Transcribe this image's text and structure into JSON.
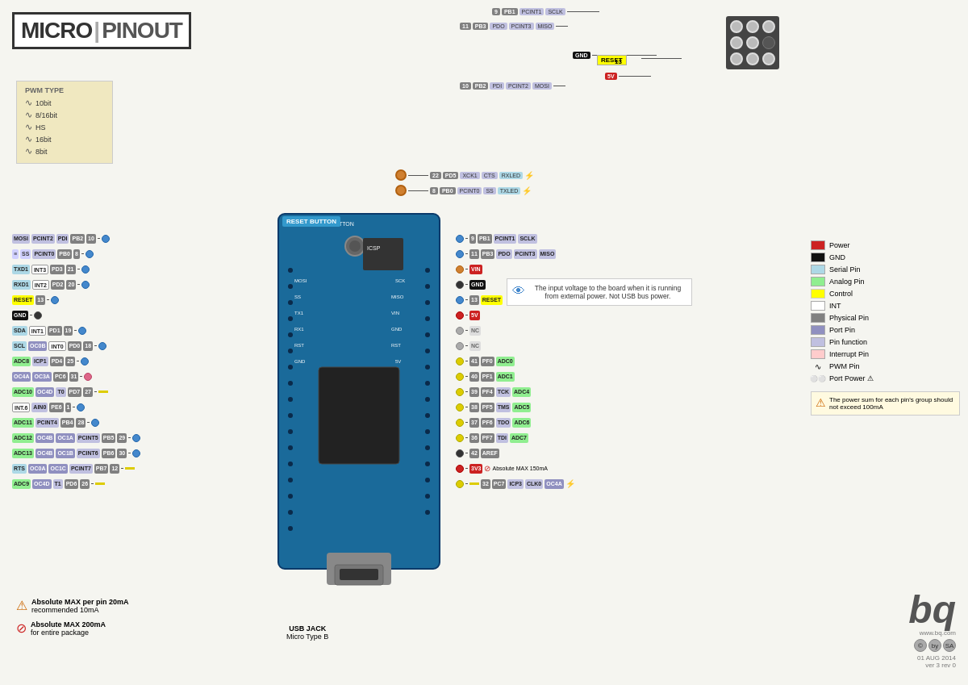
{
  "title": {
    "micro": "MICRO",
    "pinout": "PINOUT"
  },
  "pwm": {
    "title": "PWM TYPE",
    "items": [
      {
        "wave": "∿",
        "label": "10bit"
      },
      {
        "wave": "∿",
        "label": "8/16bit"
      },
      {
        "wave": "∿",
        "label": "HS"
      },
      {
        "wave": "∿",
        "label": "16bit"
      },
      {
        "wave": "∿",
        "label": "8bit"
      }
    ]
  },
  "legend": {
    "items": [
      {
        "color": "#cc2222",
        "label": "Power"
      },
      {
        "color": "#111111",
        "label": "GND"
      },
      {
        "color": "#add8e6",
        "label": "Serial Pin"
      },
      {
        "color": "#90ee90",
        "label": "Analog Pin"
      },
      {
        "color": "#ffff00",
        "label": "Control"
      },
      {
        "color": "#ffffff",
        "label": "INT"
      },
      {
        "color": "#808080",
        "label": "Physical Pin"
      },
      {
        "color": "#9090c0",
        "label": "Port Pin"
      },
      {
        "color": "#c0c0e0",
        "label": "Pin function"
      },
      {
        "color": "#ffcccc",
        "label": "Interrupt Pin"
      },
      {
        "color": "#ffffff",
        "label": "PWM Pin"
      },
      {
        "color": "#ffffff",
        "label": "Port Power ⚠"
      }
    ]
  },
  "info_box": {
    "text": "The input voltage to the board when it is running from external power. Not USB bus power."
  },
  "warnings": {
    "w1_title": "Absolute MAX per pin 20mA",
    "w1_sub": "recommended 10mA",
    "w2_title": "Absolute MAX 200mA",
    "w2_sub": "for entire package",
    "w3_title": "The power sum for each pin's group should not exceed 100mA"
  },
  "usb": {
    "label1": "USB JACK",
    "label2": "Micro Type B"
  },
  "reset_button_label": "RESET BUTTON",
  "footer": {
    "website": "www.bq.com",
    "date": "01 AUG 2014",
    "version": "ver 3 rev 0"
  },
  "left_pins": [
    {
      "labels": [
        "MOSI",
        "PCINT2",
        "PDI",
        "PB2"
      ],
      "num": "10",
      "dot": "blue"
    },
    {
      "labels": [
        "≡",
        "SS",
        "PCINT0",
        "PB0"
      ],
      "num": "8",
      "dot": "blue"
    },
    {
      "labels": [
        "TXD1",
        "INT3",
        "PD3"
      ],
      "num": "21",
      "dot": "blue"
    },
    {
      "labels": [
        "RXD1",
        "INT2",
        "PD2"
      ],
      "num": "20",
      "dot": "blue"
    },
    {
      "labels": [
        "RESET"
      ],
      "num": "13",
      "dot": "blue",
      "special": "reset"
    },
    {
      "labels": [
        "GND"
      ],
      "num": "",
      "dot": "black",
      "special": "gnd"
    },
    {
      "labels": [
        "SDA",
        "INT1",
        "PD1"
      ],
      "num": "19",
      "dot": "blue"
    },
    {
      "labels": [
        "SCL",
        "OC0B",
        "INT0",
        "PD0"
      ],
      "num": "18",
      "dot": "blue"
    },
    {
      "labels": [
        "ADC8",
        "ICP1",
        "PD4"
      ],
      "num": "25",
      "dot": "blue"
    },
    {
      "labels": [
        "OC4A",
        "OC3A",
        "PC6"
      ],
      "num": "31",
      "dot": "pink"
    },
    {
      "labels": [
        "ADC10",
        "OC4D",
        "T0",
        "PD7"
      ],
      "num": "27",
      "dot": "yellow"
    },
    {
      "labels": [
        "INT.6",
        "AIN0",
        "PE6"
      ],
      "num": "1",
      "dot": "blue"
    },
    {
      "labels": [
        "ADC11",
        "PCINT4",
        "PB4"
      ],
      "num": "28",
      "dot": "blue"
    },
    {
      "labels": [
        "ADC12",
        "OC4B",
        "OC1A",
        "PCINT5",
        "PB5"
      ],
      "num": "29",
      "dot": "blue"
    },
    {
      "labels": [
        "ADC13",
        "OC4B",
        "OC1B",
        "PCINT6",
        "PB6"
      ],
      "num": "30",
      "dot": "blue"
    },
    {
      "labels": [
        "RTS",
        "OC0A",
        "OC1C",
        "PCINT7",
        "PB7"
      ],
      "num": "12",
      "dot": "yellow"
    },
    {
      "labels": [
        "ADC9",
        "OC4D",
        "T1",
        "PD6"
      ],
      "num": "26",
      "dot": "yellow"
    }
  ],
  "right_pins": [
    {
      "labels": [
        "PB1",
        "PCINT1",
        "SCLK"
      ],
      "num": "9"
    },
    {
      "labels": [
        "PB3",
        "PDO",
        "PCINT3",
        "MISO"
      ],
      "num": "11"
    },
    {
      "special": "VIN",
      "label": "VIN"
    },
    {
      "special": "GND",
      "label": "GND"
    },
    {
      "special": "RESET",
      "label": "RESET",
      "num": "13"
    },
    {
      "special": "5V",
      "label": "5V"
    },
    {
      "special": "NC",
      "label": "NC"
    },
    {
      "special": "NC",
      "label": "NC"
    },
    {
      "labels": [
        "PF0",
        "ADC0"
      ],
      "num": "41"
    },
    {
      "labels": [
        "PF1",
        "ADC1"
      ],
      "num": "40"
    },
    {
      "labels": [
        "PF4",
        "TCK",
        "ADC4"
      ],
      "num": "39"
    },
    {
      "labels": [
        "PF5",
        "TMS",
        "ADC5"
      ],
      "num": "38"
    },
    {
      "labels": [
        "PF6",
        "TDO",
        "ADC6"
      ],
      "num": "37"
    },
    {
      "labels": [
        "PF7",
        "TDI",
        "ADC7"
      ],
      "num": "36"
    },
    {
      "special": "AREF",
      "label": "AREF",
      "num": "42"
    },
    {
      "special": "3V3",
      "label": "3V3"
    },
    {
      "labels": [
        "PC7",
        "ICP3",
        "CLK0",
        "OC4A"
      ],
      "num": "32"
    }
  ],
  "top_right_pins": [
    {
      "num": "22",
      "labels": [
        "PD5",
        "XCK1",
        "CTS"
      ],
      "led": "RXLED"
    },
    {
      "num": "8",
      "labels": [
        "PB0",
        "PCINT0",
        "SS"
      ],
      "led": "TXLED"
    }
  ],
  "icsp_top": {
    "label": "RESET",
    "num": "13",
    "connections": [
      "9 PB1 PCINT1 SCLK",
      "11 PB3 PDO PCINT3 MISO",
      "GND",
      "5V",
      "10 PB2 PDI PCINT2 MOSI"
    ]
  }
}
